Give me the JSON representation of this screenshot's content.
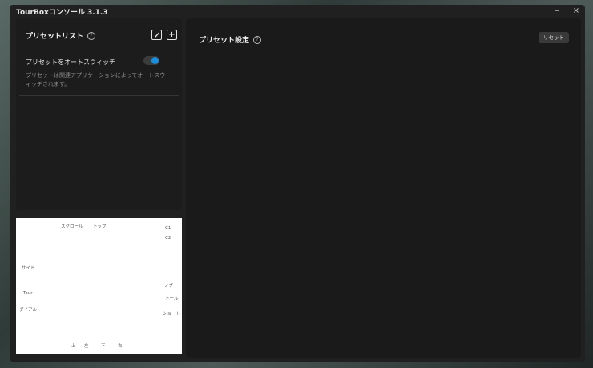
{
  "window": {
    "title": "TourBoxコンソール 3.1.3",
    "minimize": "–",
    "close": "×"
  },
  "preset_list": {
    "title": "プリセットリスト",
    "help": "?",
    "add": "+",
    "auto_switch": {
      "label": "プリセットをオートスウィッチ",
      "enabled": true,
      "description": "プリセットは関連アプリケーションによってオートスウィッチされます。"
    }
  },
  "device_labels": {
    "scroll": "スクロール",
    "top": "トップ",
    "c1": "C1",
    "c2": "C2",
    "side": "サイド",
    "knob": "ノブ",
    "tour": "Tour",
    "tall": "トール",
    "dial": "ダイアル",
    "short": "ショート",
    "up": "上",
    "left": "左",
    "down": "下",
    "right": "右"
  },
  "preset_settings": {
    "title": "プリセット設定",
    "help": "?",
    "reset_label": "リセット"
  }
}
